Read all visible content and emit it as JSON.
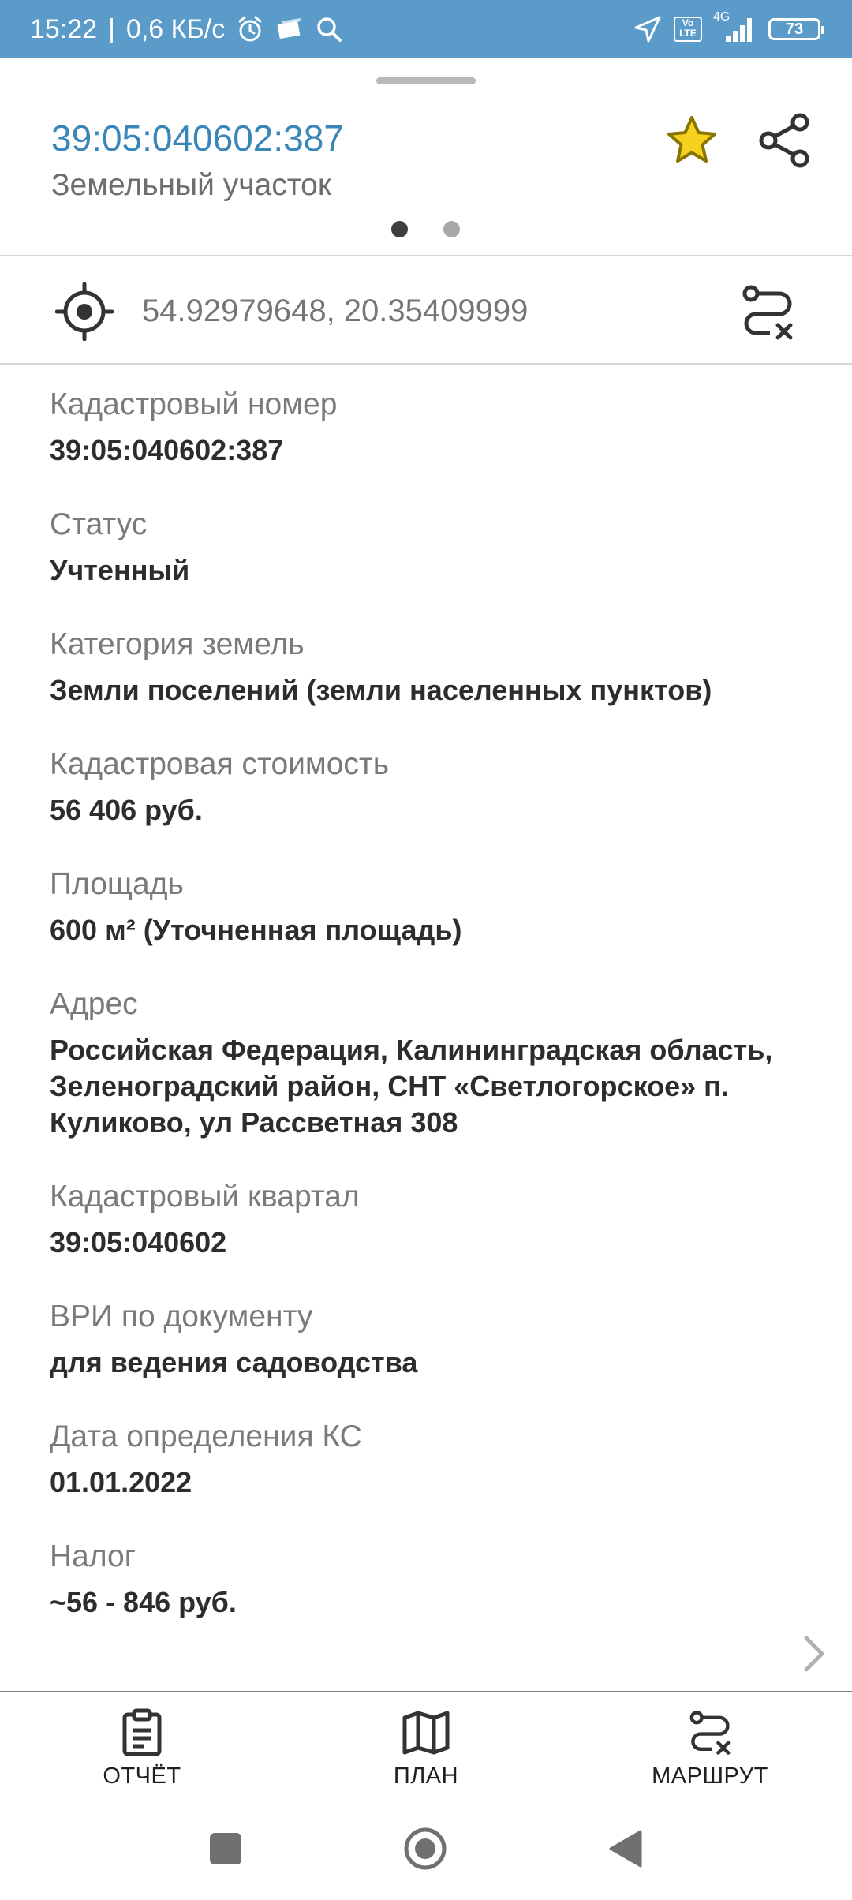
{
  "status_bar": {
    "time": "15:22",
    "separator": "|",
    "speed": "0,6 КБ/с",
    "network": "4G",
    "volte_top": "Vo",
    "volte_bottom": "LTE",
    "battery": "73"
  },
  "header": {
    "title": "39:05:040602:387",
    "subtitle": "Земельный участок",
    "page_count": 2,
    "active_page": 1
  },
  "location": {
    "coordinates": "54.92979648, 20.35409999"
  },
  "properties": [
    {
      "label": "Кадастровый номер",
      "value": "39:05:040602:387"
    },
    {
      "label": "Статус",
      "value": "Учтенный"
    },
    {
      "label": "Категория земель",
      "value": "Земли поселений (земли населенных пунктов)"
    },
    {
      "label": "Кадастровая стоимость",
      "value": "56 406 руб."
    },
    {
      "label": "Площадь",
      "value": "600 м² (Уточненная площадь)"
    },
    {
      "label": "Адрес",
      "value": "Российская Федерация, Калининградская область, Зеленоградский район, СНТ «Светлогорское» п. Куликово, ул Рассветная 308"
    },
    {
      "label": "Кадастровый квартал",
      "value": "39:05:040602"
    },
    {
      "label": "ВРИ по документу",
      "value": "для ведения садоводства"
    },
    {
      "label": "Дата определения КС",
      "value": "01.01.2022"
    },
    {
      "label": "Налог",
      "value": "~56 - 846 руб."
    }
  ],
  "bottom_nav": {
    "report_label": "ОТЧЁТ",
    "plan_label": "ПЛАН",
    "route_label": "МАРШРУТ"
  },
  "colors": {
    "status_bar": "#5b9bc9",
    "title_accent": "#3b86b8",
    "favorite_star": "#e8c21c",
    "label_gray": "#7a7a7a",
    "value_dark": "#2d2d2d"
  },
  "icons": {
    "favorite": "star-icon",
    "share": "share-icon",
    "location": "target-icon",
    "route_cancel": "route-cancel-icon",
    "report": "clipboard-icon",
    "plan": "map-icon",
    "route": "route-cancel-icon"
  }
}
